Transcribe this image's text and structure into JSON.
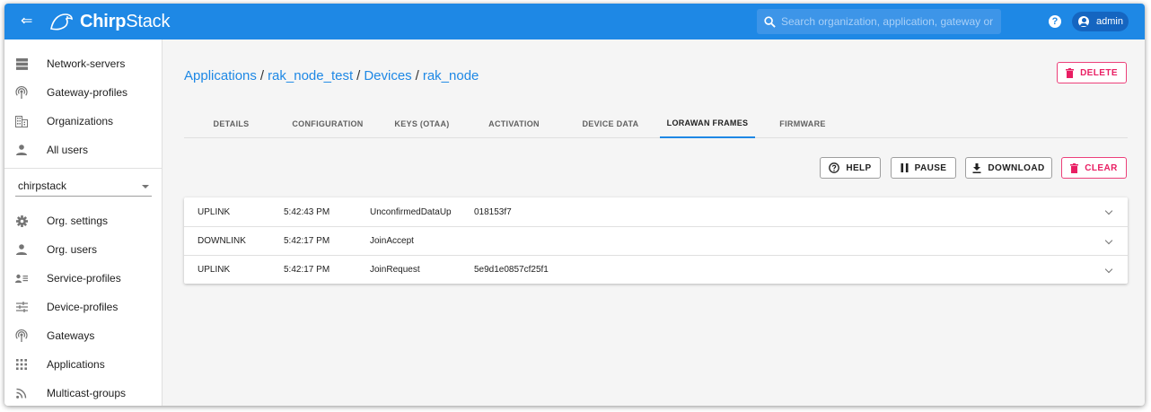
{
  "topbar": {
    "menu_toggle": "⇐",
    "logo_prefix": "Chirp",
    "logo_suffix": "Stack",
    "search_placeholder": "Search organization, application, gateway or device",
    "help": "?",
    "user": "admin"
  },
  "sidebar": {
    "admin_items": [
      {
        "label": "Network-servers",
        "icon": "server-icon"
      },
      {
        "label": "Gateway-profiles",
        "icon": "gateway-icon"
      },
      {
        "label": "Organizations",
        "icon": "building-icon"
      },
      {
        "label": "All users",
        "icon": "person-icon"
      }
    ],
    "org_select": "chirpstack",
    "org_items": [
      {
        "label": "Org. settings",
        "icon": "gear-icon"
      },
      {
        "label": "Org. users",
        "icon": "person-icon"
      },
      {
        "label": "Service-profiles",
        "icon": "account-details-icon"
      },
      {
        "label": "Device-profiles",
        "icon": "tune-icon"
      },
      {
        "label": "Gateways",
        "icon": "gateway-icon"
      },
      {
        "label": "Applications",
        "icon": "apps-icon"
      },
      {
        "label": "Multicast-groups",
        "icon": "rss-icon"
      }
    ]
  },
  "breadcrumb": {
    "applications": "Applications",
    "application": "rak_node_test",
    "devices": "Devices",
    "device": "rak_node",
    "separator": "/"
  },
  "actions": {
    "delete": "DELETE",
    "help": "HELP",
    "pause": "PAUSE",
    "download": "DOWNLOAD",
    "clear": "CLEAR"
  },
  "tabs": [
    {
      "label": "DETAILS"
    },
    {
      "label": "CONFIGURATION"
    },
    {
      "label": "KEYS (OTAA)"
    },
    {
      "label": "ACTIVATION"
    },
    {
      "label": "DEVICE DATA"
    },
    {
      "label": "LORAWAN FRAMES",
      "active": true
    },
    {
      "label": "FIRMWARE"
    }
  ],
  "frames": [
    {
      "direction": "UPLINK",
      "time": "5:42:43 PM",
      "type": "UnconfirmedDataUp",
      "id": "018153f7"
    },
    {
      "direction": "DOWNLINK",
      "time": "5:42:17 PM",
      "type": "JoinAccept",
      "id": ""
    },
    {
      "direction": "UPLINK",
      "time": "5:42:17 PM",
      "type": "JoinRequest",
      "id": "5e9d1e0857cf25f1"
    }
  ],
  "colors": {
    "primary": "#1e88e5",
    "danger": "#e91e63"
  }
}
